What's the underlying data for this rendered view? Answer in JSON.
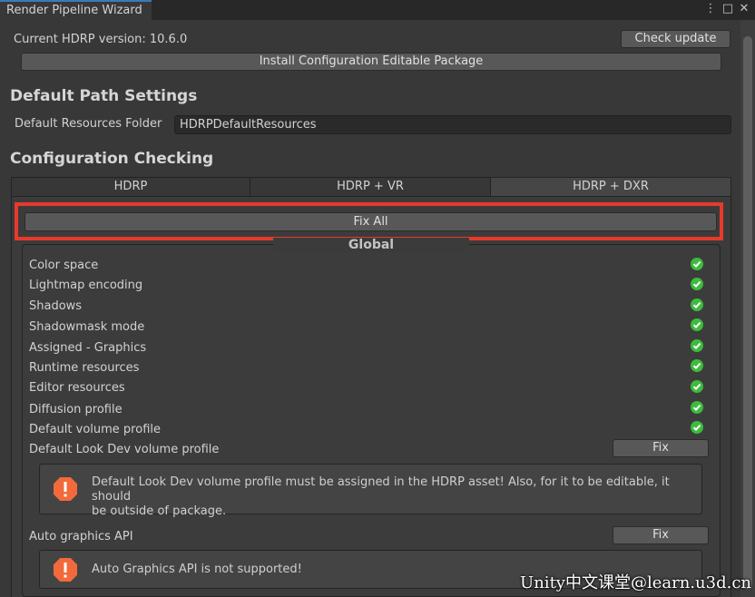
{
  "window": {
    "title": "Render Pipeline Wizard",
    "menu_glyph": "⋮",
    "maximize_glyph": "□",
    "close_glyph": "✕"
  },
  "header": {
    "version_label": "Current HDRP version: 10.6.0",
    "check_update_label": "Check update",
    "install_package_label": "Install Configuration Editable Package"
  },
  "default_path": {
    "heading": "Default Path Settings",
    "resources_label": "Default Resources Folder",
    "resources_value": "HDRPDefaultResources"
  },
  "config": {
    "heading": "Configuration Checking",
    "tabs": [
      {
        "label": "HDRP",
        "active": false
      },
      {
        "label": "HDRP + VR",
        "active": false
      },
      {
        "label": "HDRP + DXR",
        "active": true
      }
    ],
    "fix_all_label": "Fix All",
    "group_title": "Global",
    "checks": [
      {
        "label": "Color space",
        "status": "ok"
      },
      {
        "label": "Lightmap encoding",
        "status": "ok"
      },
      {
        "label": "Shadows",
        "status": "ok"
      },
      {
        "label": "Shadowmask mode",
        "status": "ok"
      },
      {
        "label": "Assigned - Graphics",
        "status": "ok"
      },
      {
        "label": "Runtime resources",
        "status": "ok"
      },
      {
        "label": "Editor resources",
        "status": "ok"
      },
      {
        "label": "Diffusion profile",
        "status": "ok"
      },
      {
        "label": "Default volume profile",
        "status": "ok"
      }
    ],
    "failing": [
      {
        "label": "Default Look Dev volume profile",
        "fix_label": "Fix",
        "message_line1": "Default Look Dev volume profile must be assigned in the HDRP asset! Also, for it to be editable, it should",
        "message_line2": "be outside of package."
      },
      {
        "label": "Auto graphics API",
        "fix_label": "Fix",
        "message_line1": "Auto Graphics API is not supported!"
      }
    ]
  },
  "watermark": "Unity中文课堂@learn.u3d.cn",
  "colors": {
    "accent_highlight": "#e8392b",
    "check_ok": "#3dbb3d",
    "error_icon": "#f26a3c"
  }
}
